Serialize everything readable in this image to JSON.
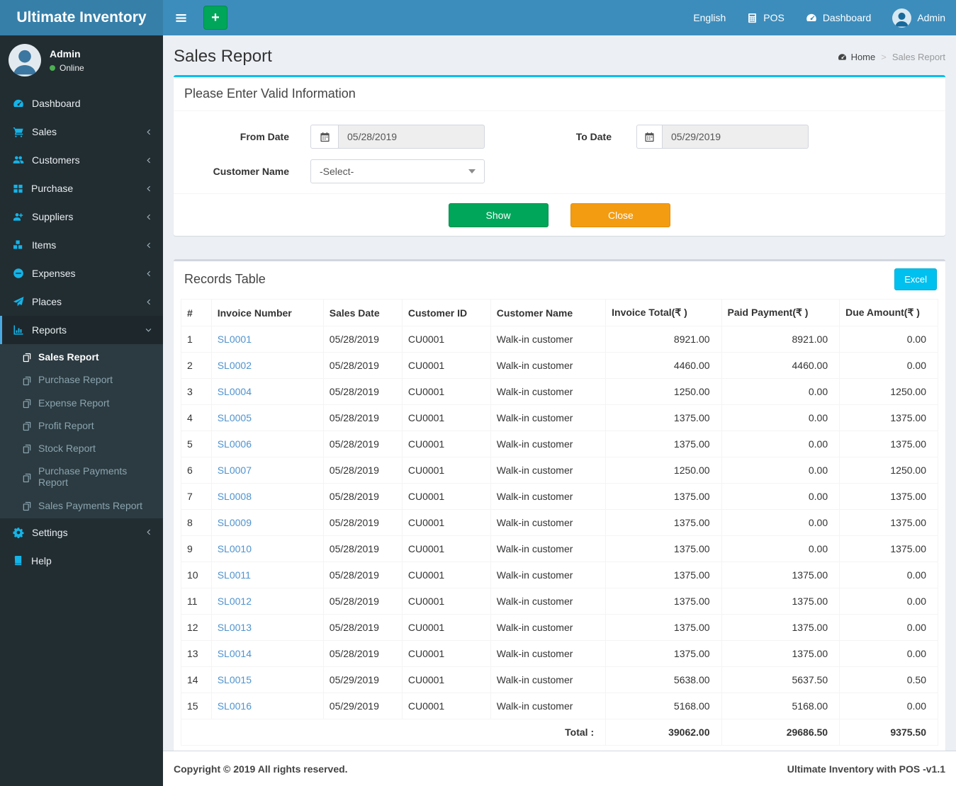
{
  "app": {
    "name": "Ultimate Inventory"
  },
  "topbar": {
    "add_button": "+",
    "language": "English",
    "pos": "POS",
    "dashboard": "Dashboard",
    "user": "Admin"
  },
  "sidebar": {
    "user": {
      "name": "Admin",
      "status": "Online"
    },
    "items": [
      {
        "label": "Dashboard",
        "icon": "gauge-icon",
        "chevron": "none"
      },
      {
        "label": "Sales",
        "icon": "cart-icon",
        "chevron": "left"
      },
      {
        "label": "Customers",
        "icon": "users-icon",
        "chevron": "left"
      },
      {
        "label": "Purchase",
        "icon": "grid-icon",
        "chevron": "left"
      },
      {
        "label": "Suppliers",
        "icon": "user-plus-icon",
        "chevron": "left"
      },
      {
        "label": "Items",
        "icon": "cubes-icon",
        "chevron": "left"
      },
      {
        "label": "Expenses",
        "icon": "minus-circle-icon",
        "chevron": "left"
      },
      {
        "label": "Places",
        "icon": "paper-plane-icon",
        "chevron": "left"
      }
    ],
    "reports": {
      "label": "Reports",
      "icon": "bar-chart-icon",
      "chevron": "down",
      "children": [
        {
          "label": "Sales Report",
          "icon": "copy-icon",
          "active": true
        },
        {
          "label": "Purchase Report",
          "icon": "copy-icon",
          "active": false
        },
        {
          "label": "Expense Report",
          "icon": "copy-icon",
          "active": false
        },
        {
          "label": "Profit Report",
          "icon": "copy-icon",
          "active": false
        },
        {
          "label": "Stock Report",
          "icon": "copy-icon",
          "active": false
        },
        {
          "label": "Purchase Payments Report",
          "icon": "copy-icon",
          "active": false
        },
        {
          "label": "Sales Payments Report",
          "icon": "copy-icon",
          "active": false
        }
      ]
    },
    "settings": {
      "label": "Settings",
      "icon": "gear-icon",
      "chevron": "left"
    },
    "help": {
      "label": "Help",
      "icon": "book-icon",
      "chevron": "none"
    }
  },
  "page": {
    "title": "Sales Report",
    "breadcrumb": {
      "home": "Home",
      "current": "Sales Report"
    }
  },
  "filter": {
    "header": "Please Enter Valid Information",
    "from_label": "From Date",
    "from_value": "05/28/2019",
    "to_label": "To Date",
    "to_value": "05/29/2019",
    "customer_label": "Customer Name",
    "customer_value": "-Select-",
    "show_button": "Show",
    "close_button": "Close"
  },
  "records_table": {
    "title": "Records Table",
    "excel_button": "Excel",
    "columns": [
      {
        "key": "num",
        "label": "#",
        "align": "left"
      },
      {
        "key": "invoice_number",
        "label": "Invoice Number",
        "align": "left",
        "link": true
      },
      {
        "key": "sales_date",
        "label": "Sales Date",
        "align": "left"
      },
      {
        "key": "customer_id",
        "label": "Customer ID",
        "align": "left"
      },
      {
        "key": "customer_name",
        "label": "Customer Name",
        "align": "left"
      },
      {
        "key": "invoice_total",
        "label": "Invoice Total(₹ )",
        "align": "right"
      },
      {
        "key": "paid_payment",
        "label": "Paid Payment(₹ )",
        "align": "right"
      },
      {
        "key": "due_amount",
        "label": "Due Amount(₹ )",
        "align": "right"
      }
    ],
    "rows": [
      [
        "1",
        "SL0001",
        "05/28/2019",
        "CU0001",
        "Walk-in customer",
        "8921.00",
        "8921.00",
        "0.00"
      ],
      [
        "2",
        "SL0002",
        "05/28/2019",
        "CU0001",
        "Walk-in customer",
        "4460.00",
        "4460.00",
        "0.00"
      ],
      [
        "3",
        "SL0004",
        "05/28/2019",
        "CU0001",
        "Walk-in customer",
        "1250.00",
        "0.00",
        "1250.00"
      ],
      [
        "4",
        "SL0005",
        "05/28/2019",
        "CU0001",
        "Walk-in customer",
        "1375.00",
        "0.00",
        "1375.00"
      ],
      [
        "5",
        "SL0006",
        "05/28/2019",
        "CU0001",
        "Walk-in customer",
        "1375.00",
        "0.00",
        "1375.00"
      ],
      [
        "6",
        "SL0007",
        "05/28/2019",
        "CU0001",
        "Walk-in customer",
        "1250.00",
        "0.00",
        "1250.00"
      ],
      [
        "7",
        "SL0008",
        "05/28/2019",
        "CU0001",
        "Walk-in customer",
        "1375.00",
        "0.00",
        "1375.00"
      ],
      [
        "8",
        "SL0009",
        "05/28/2019",
        "CU0001",
        "Walk-in customer",
        "1375.00",
        "0.00",
        "1375.00"
      ],
      [
        "9",
        "SL0010",
        "05/28/2019",
        "CU0001",
        "Walk-in customer",
        "1375.00",
        "0.00",
        "1375.00"
      ],
      [
        "10",
        "SL0011",
        "05/28/2019",
        "CU0001",
        "Walk-in customer",
        "1375.00",
        "1375.00",
        "0.00"
      ],
      [
        "11",
        "SL0012",
        "05/28/2019",
        "CU0001",
        "Walk-in customer",
        "1375.00",
        "1375.00",
        "0.00"
      ],
      [
        "12",
        "SL0013",
        "05/28/2019",
        "CU0001",
        "Walk-in customer",
        "1375.00",
        "1375.00",
        "0.00"
      ],
      [
        "13",
        "SL0014",
        "05/28/2019",
        "CU0001",
        "Walk-in customer",
        "1375.00",
        "1375.00",
        "0.00"
      ],
      [
        "14",
        "SL0015",
        "05/29/2019",
        "CU0001",
        "Walk-in customer",
        "5638.00",
        "5637.50",
        "0.50"
      ],
      [
        "15",
        "SL0016",
        "05/29/2019",
        "CU0001",
        "Walk-in customer",
        "5168.00",
        "5168.00",
        "0.00"
      ]
    ],
    "total": {
      "label": "Total :",
      "values": [
        "39062.00",
        "29686.50",
        "9375.50"
      ]
    }
  },
  "footer": {
    "copyright": "Copyright © 2019 All rights reserved.",
    "version": "Ultimate Inventory with POS -v1.1"
  },
  "colors": {
    "navbar": "#3c8dbc",
    "logo_bg": "#367fa9",
    "sidebar_bg": "#222d32",
    "accent_cyan": "#00c0ef",
    "success_green": "#00a65a",
    "warning_orange": "#f39c12",
    "link_blue": "#4f93ce"
  }
}
